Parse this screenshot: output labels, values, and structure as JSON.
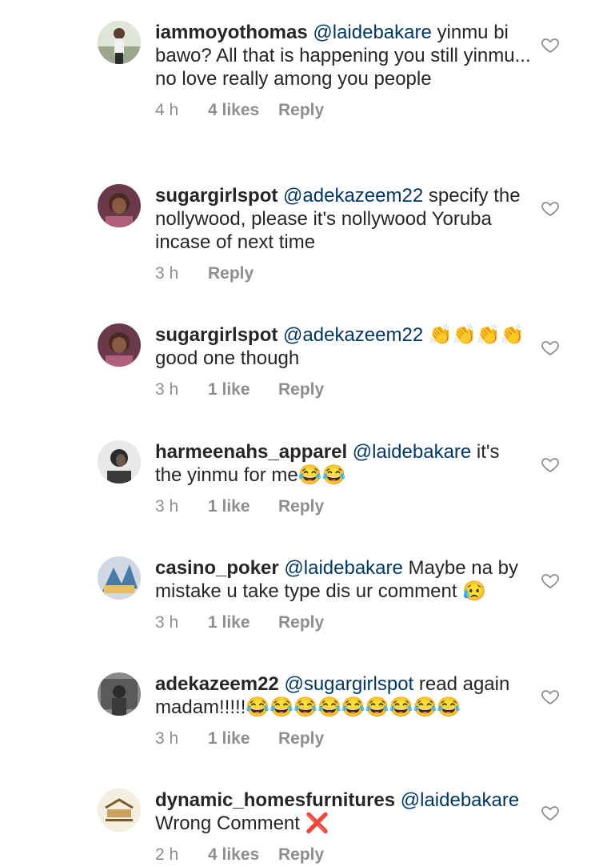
{
  "comments": [
    {
      "username": "iammoyothomas",
      "mention": "@laidebakare",
      "text": " yinmu bi bawo? All that is happening you still yinmu... no love really  among you people",
      "time": "4 h",
      "likes": "4 likes",
      "reply": "Reply",
      "avatar_color": "#6b7d5b"
    },
    {
      "username": "sugargirlspot",
      "mention": "@adekazeem22",
      "text": " specify the nollywood, please it's nollywood Yoruba incase of next time",
      "time": "3 h",
      "likes": "",
      "reply": "Reply",
      "avatar_color": "#3a1f28"
    },
    {
      "username": "sugargirlspot",
      "mention": "@adekazeem22",
      "text": " 👏👏👏👏 good one though",
      "time": "3 h",
      "likes": "1 like",
      "reply": "Reply",
      "avatar_color": "#3a1f28"
    },
    {
      "username": "harmeenahs_apparel",
      "mention": "@laidebakare",
      "text": " it's the yinmu for me😂😂",
      "time": "3 h",
      "likes": "1 like",
      "reply": "Reply",
      "avatar_color": "#2f2f2f"
    },
    {
      "username": "casino_poker",
      "mention": "@laidebakare",
      "text": " Maybe na by mistake u take type dis ur comment 😥",
      "time": "3 h",
      "likes": "1 like",
      "reply": "Reply",
      "avatar_color": "#4b7aa6"
    },
    {
      "username": "adekazeem22",
      "mention": "@sugargirlspot",
      "text": " read again madam!!!!!😂😂😂😂😂😂😂😂😂",
      "time": "3 h",
      "likes": "1 like",
      "reply": "Reply",
      "avatar_color": "#555555"
    },
    {
      "username": "dynamic_homesfurnitures",
      "mention": "@laidebakare",
      "text": " Wrong Comment ❌",
      "time": "2 h",
      "likes": "4 likes",
      "reply": "Reply",
      "avatar_color": "#efe6cf"
    }
  ],
  "icons": {
    "like": "heart-outline-icon"
  }
}
